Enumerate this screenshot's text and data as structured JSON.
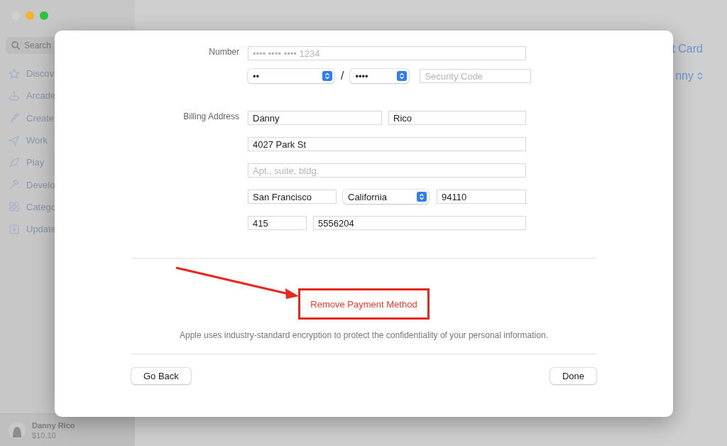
{
  "sidebar": {
    "search": {
      "placeholder": "Search"
    },
    "items": [
      {
        "label": "Discov"
      },
      {
        "label": "Arcade"
      },
      {
        "label": "Create"
      },
      {
        "label": "Work"
      },
      {
        "label": "Play"
      },
      {
        "label": "Develo"
      },
      {
        "label": "Catego"
      },
      {
        "label": "Update"
      }
    ],
    "account": {
      "name": "Danny Rico",
      "balance": "$10.10"
    }
  },
  "main": {
    "link": "t Card",
    "account_menu": "nny"
  },
  "dialog": {
    "card": {
      "label": "Number",
      "number": {
        "placeholder": "•••• •••• •••• 1234"
      },
      "month": {
        "value": "••"
      },
      "separator": "/",
      "year": {
        "value": "••••"
      },
      "security": {
        "placeholder": "Security Code"
      }
    },
    "billing": {
      "label": "Billing Address",
      "rows": [
        [
          {
            "kind": "text",
            "value": "Danny"
          },
          {
            "kind": "text",
            "value": "Rico"
          }
        ],
        [
          {
            "kind": "text",
            "value": "4027 Park St"
          }
        ],
        [
          {
            "kind": "text",
            "placeholder": "Apt., suite, bldg."
          }
        ],
        [
          {
            "kind": "text",
            "value": "San Francisco"
          },
          {
            "kind": "select",
            "value": "California"
          },
          {
            "kind": "text",
            "value": "94110"
          }
        ],
        [
          {
            "kind": "text",
            "value": "415"
          },
          {
            "kind": "text",
            "value": "5556204"
          }
        ]
      ]
    },
    "remove_button": "Remove Payment Method",
    "info": "Apple uses industry-standard encryption to protect the confidentiality of your personal information.",
    "buttons": [
      "Go Back",
      "Done"
    ]
  }
}
